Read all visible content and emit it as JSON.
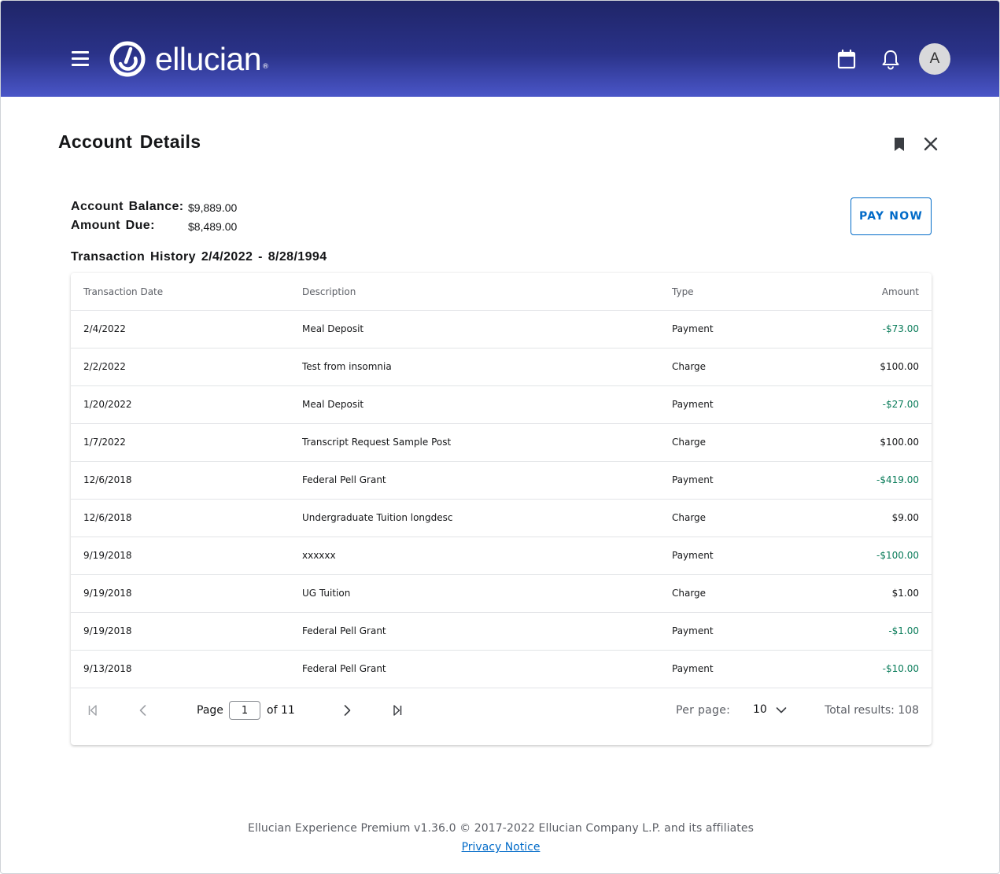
{
  "header": {
    "brand": "ellucian",
    "avatar_initial": "A",
    "colors": {
      "gradient_top": "#1f2568",
      "gradient_bottom": "#4a56c8"
    }
  },
  "page": {
    "title": "Account Details"
  },
  "account": {
    "balance_label": "Account Balance:",
    "balance_value": "$9,889.00",
    "due_label": "Amount Due:",
    "due_value": "$8,489.00",
    "pay_button": "PAY NOW"
  },
  "history": {
    "title": "Transaction History 2/4/2022 - 8/28/1994",
    "columns": {
      "date": "Transaction Date",
      "description": "Description",
      "type": "Type",
      "amount": "Amount"
    },
    "rows": [
      {
        "date": "2/4/2022",
        "description": "Meal Deposit",
        "type": "Payment",
        "amount": "-$73.00"
      },
      {
        "date": "2/2/2022",
        "description": "Test from insomnia",
        "type": "Charge",
        "amount": "$100.00"
      },
      {
        "date": "1/20/2022",
        "description": "Meal Deposit",
        "type": "Payment",
        "amount": "-$27.00"
      },
      {
        "date": "1/7/2022",
        "description": "Transcript Request Sample Post",
        "type": "Charge",
        "amount": "$100.00"
      },
      {
        "date": "12/6/2018",
        "description": "Federal Pell Grant",
        "type": "Payment",
        "amount": "-$419.00"
      },
      {
        "date": "12/6/2018",
        "description": "Undergraduate Tuition longdesc",
        "type": "Charge",
        "amount": "$9.00"
      },
      {
        "date": "9/19/2018",
        "description": "xxxxxx",
        "type": "Payment",
        "amount": "-$100.00"
      },
      {
        "date": "9/19/2018",
        "description": "UG Tuition",
        "type": "Charge",
        "amount": "$1.00"
      },
      {
        "date": "9/19/2018",
        "description": "Federal Pell Grant",
        "type": "Payment",
        "amount": "-$1.00"
      },
      {
        "date": "9/13/2018",
        "description": "Federal Pell Grant",
        "type": "Payment",
        "amount": "-$10.00"
      }
    ],
    "credit_color": "#0a7c5a"
  },
  "pager": {
    "page_label": "Page",
    "page_value": "1",
    "of_label": "of 11",
    "per_page_label": "Per page:",
    "per_page_value": "10",
    "total_results": "Total results: 108"
  },
  "footer": {
    "text": "Ellucian Experience Premium v1.36.0 © 2017-2022 Ellucian Company L.P. and its affiliates",
    "privacy_link": "Privacy Notice"
  },
  "icons": [
    "menu-icon",
    "ellucian-logo-icon",
    "calendar-icon",
    "bell-icon",
    "bookmark-icon",
    "close-icon",
    "first-page-icon",
    "prev-page-icon",
    "next-page-icon",
    "last-page-icon",
    "chevron-down-icon"
  ]
}
